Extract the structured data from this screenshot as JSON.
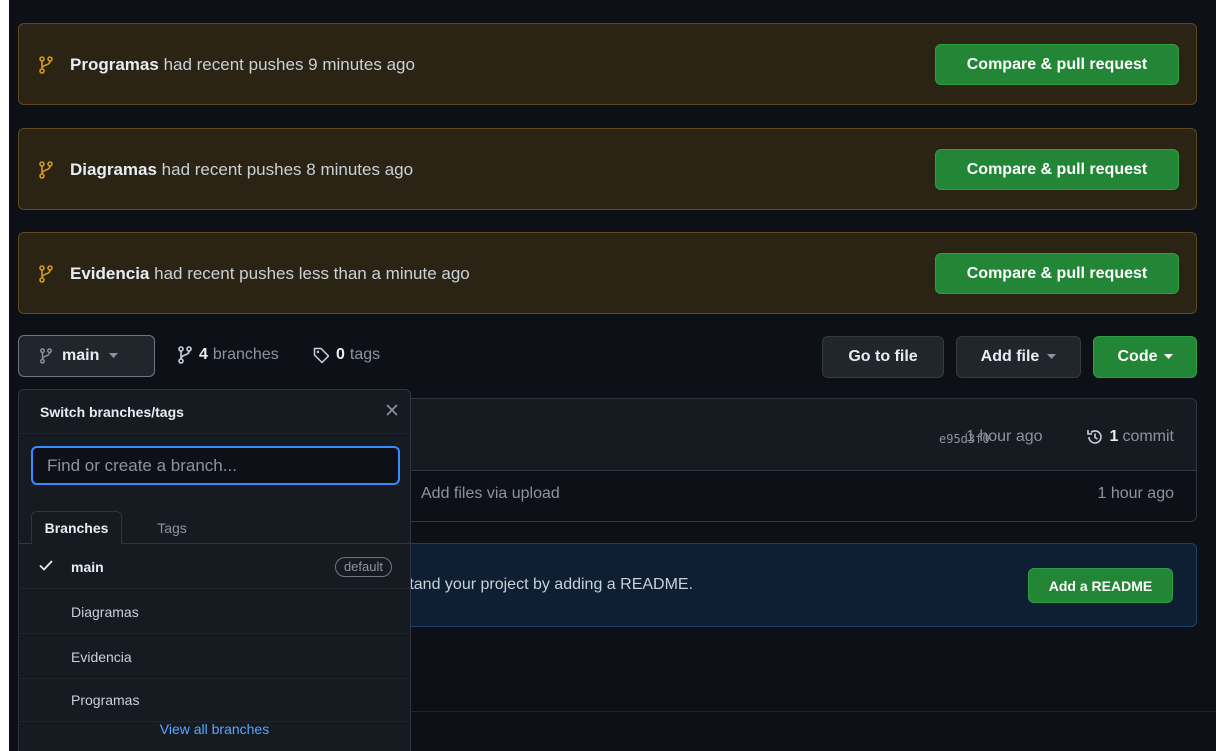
{
  "banners": [
    {
      "branch": "Programas",
      "text": "had recent pushes 9 minutes ago",
      "button": "Compare & pull request"
    },
    {
      "branch": "Diagramas",
      "text": "had recent pushes 8 minutes ago",
      "button": "Compare & pull request"
    },
    {
      "branch": "Evidencia",
      "text": "had recent pushes less than a minute ago",
      "button": "Compare & pull request"
    }
  ],
  "toolbar": {
    "branch": "main",
    "branches_count": "4",
    "branches_label": "branches",
    "tags_count": "0",
    "tags_label": "tags",
    "go_to_file": "Go to file",
    "add_file": "Add file",
    "code": "Code"
  },
  "file_box": {
    "sha": "e95d3f0",
    "time": "1 hour ago",
    "commits_count": "1",
    "commits_label": "commit",
    "commit_message": "Add files via upload",
    "file_time": "1 hour ago"
  },
  "readme": {
    "text": "rstand your project by adding a README.",
    "button": "Add a README"
  },
  "dropdown": {
    "title": "Switch branches/tags",
    "search_placeholder": "Find or create a branch...",
    "tabs": [
      "Branches",
      "Tags"
    ],
    "items": [
      {
        "name": "main",
        "badge": "default"
      },
      {
        "name": "Diagramas"
      },
      {
        "name": "Evidencia"
      },
      {
        "name": "Programas"
      }
    ],
    "footer": "View all branches"
  },
  "colors": {
    "background": "#0d1117",
    "banner_bg": "#2b2414",
    "primary_button": "#238636",
    "link": "#58a6ff",
    "focus": "#388bfd"
  }
}
